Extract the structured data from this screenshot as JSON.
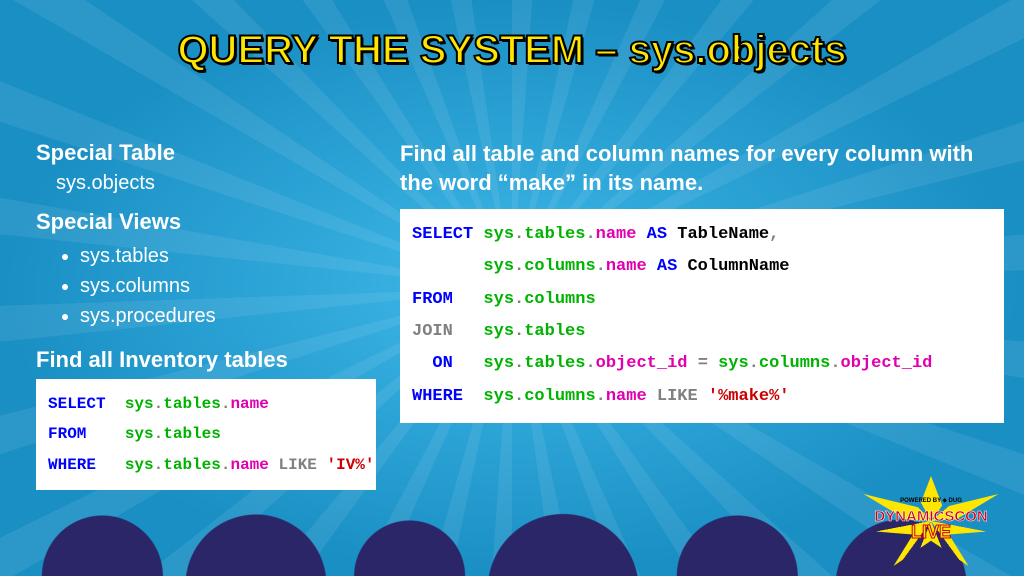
{
  "title": "QUERY THE SYSTEM – sys.objects",
  "left": {
    "h1": "Special Table",
    "sub1": "sys.objects",
    "h2": "Special Views",
    "views": [
      "sys.tables",
      "sys.columns",
      "sys.procedures"
    ],
    "h3": "Find all Inventory tables",
    "code1": {
      "select": "SELECT",
      "from": "FROM",
      "where": "WHERE",
      "sys": "sys",
      "tables": "tables",
      "name": "name",
      "like": "LIKE",
      "lit": "'IV%'"
    }
  },
  "right": {
    "prompt": "Find all table and column names for every column with the word “make” in its name.",
    "code2": {
      "select": "SELECT",
      "from": "FROM",
      "join": "JOIN",
      "on": "ON",
      "where": "WHERE",
      "as": "AS",
      "like": "LIKE",
      "sys": "sys",
      "tables": "tables",
      "columns": "columns",
      "name": "name",
      "objid": "object_id",
      "aliasT": "TableName",
      "aliasC": "ColumnName",
      "lit": "'%make%'"
    }
  },
  "logo": {
    "powered": "POWERED BY ⬥ DUG",
    "line1": "DYNAMICSCON",
    "line2": "LIVE"
  }
}
